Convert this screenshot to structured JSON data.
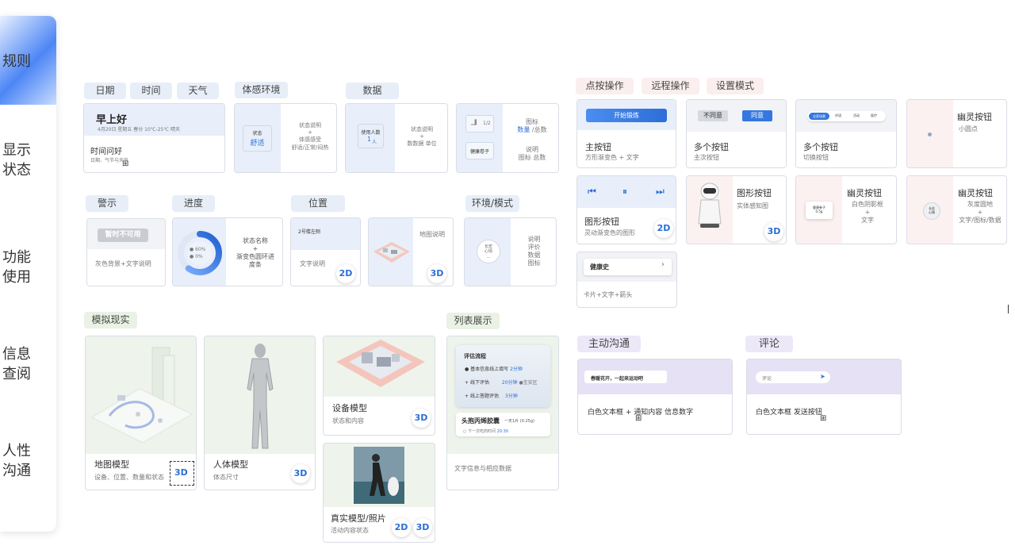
{
  "sidebar": {
    "items": [
      "规则",
      "显示\n状态",
      "功能\n使用",
      "信息\n查阅",
      "人性\n沟通"
    ]
  },
  "display": {
    "tags": {
      "date": "日期",
      "time": "时间",
      "weather": "天气",
      "env": "体感环境",
      "data": "数据"
    },
    "greeting": {
      "title": "早上好",
      "date_line": "4月20日 星期五 春分 10℃-25℃ 晴天",
      "body": "时间问好",
      "note": "日期、气节与天气"
    },
    "env_card": {
      "state_label": "状态",
      "state_value": "舒适",
      "desc": "状态说明\n+\n体感感受",
      "options": "舒适/正常/闷热"
    },
    "data_card": {
      "label": "使用人数",
      "value": "1",
      "unit": "人",
      "desc": "状态说明\n+\n数数据 单位"
    },
    "icon_card": {
      "mini_frac": "1/2",
      "mini_label": "健康卷子",
      "line1": "图标",
      "line2a": "数量",
      "line2b": " /总数",
      "line3": "说明",
      "line4": "图标 总数"
    }
  },
  "status": {
    "tags": {
      "warning": "警示",
      "progress": "进度",
      "location": "位置",
      "mode": "环境/模式"
    },
    "warning": {
      "button": "暂时不可用",
      "desc": "灰色背景+文字说明"
    },
    "progress": {
      "legend1": "60%",
      "legend2": "0%",
      "desc": "状态名称\n+\n渐变色圆环进\n度条"
    },
    "location": {
      "floor": "2号楼左侧",
      "desc": "文字说明",
      "badge": "2D"
    },
    "map": {
      "desc": "地图说明",
      "badge": "3D"
    },
    "mode": {
      "inner": "长宏\n心情\n…",
      "desc": "说明\n评价\n数据\n图标"
    }
  },
  "model": {
    "tags": {
      "sim": "模拟现实",
      "list": "列表展示"
    },
    "map_model": {
      "title": "地图模型",
      "desc": "设备、位置、数量和状态",
      "badge": "3D"
    },
    "body_model": {
      "title": "人体模型",
      "desc": "体态尺寸",
      "badge": "3D"
    },
    "device_model": {
      "title": "设备模型",
      "desc": "状态和内容",
      "badge": "3D"
    },
    "real_model": {
      "title": "真实模型/照片",
      "desc": "活动内容状态",
      "badge1": "2D",
      "badge2": "3D"
    },
    "list": {
      "panel_title": "评估流程",
      "rows": [
        {
          "text": "基本信息线上填写",
          "time": "2分钟",
          "extra": ""
        },
        {
          "text": "线下评估",
          "time": "20分钟",
          "extra": "●宝安区"
        },
        {
          "text": "线上答题评估",
          "time": "3分钟",
          "extra": ""
        }
      ],
      "task_title": "头抱丙烯胶囊",
      "task_dose": "一天1片 (0.25g)",
      "task_next": "下一次吃药时间",
      "task_time": "20:30",
      "desc": "文字信息与相应数据"
    }
  },
  "operate": {
    "tags": {
      "tap": "点按操作",
      "remote": "远程操作",
      "setting": "设置模式"
    },
    "main_btn": {
      "button": "开始锻炼",
      "title": "主按钮",
      "desc": "方形渐变色 + 文字"
    },
    "multi1": {
      "btn1": "不同意",
      "btn2": "同意",
      "title": "多个按钮",
      "desc": "主次按钮"
    },
    "multi2": {
      "seg": [
        "全家场景",
        "评语",
        "活动",
        "医疗"
      ],
      "title": "多个按钮",
      "desc": "切换按钮"
    },
    "ghost1": {
      "title": "幽灵按钮",
      "desc": "小圆点"
    },
    "icon_btn": {
      "title": "图形按钮",
      "desc": "灵动渐变色的图形",
      "badge": "2D"
    },
    "robot_btn": {
      "title": "图形按钮",
      "desc": "实体感知图",
      "badge": "3D"
    },
    "ghost2": {
      "inner": "健康卷子\n0.5g",
      "title": "幽灵按钮",
      "desc": "白色阴影框\n+\n文字"
    },
    "ghost3": {
      "inner": "长宏\n心情",
      "title": "幽灵按钮",
      "desc": "灰度圆地\n+\n文字/图标/数据"
    },
    "card_btn": {
      "label": "健康史",
      "desc": "卡片+文字+箭头"
    }
  },
  "comm": {
    "tags": {
      "active": "主动沟通",
      "comment": "评论"
    },
    "active": {
      "message": "春暖花开，一起来运动吧",
      "desc": "白色文本框 + 通知内容  信息数字"
    },
    "comment": {
      "placeholder": "评论",
      "desc": "白色文本框  发送按钮"
    }
  },
  "colors": {
    "accent": "#2b6fd6",
    "blue_tag": "#e7eef8",
    "green_tag": "#e9f2e5",
    "pink_tag": "#fbeeee",
    "purple_tag": "#ece8f8"
  }
}
